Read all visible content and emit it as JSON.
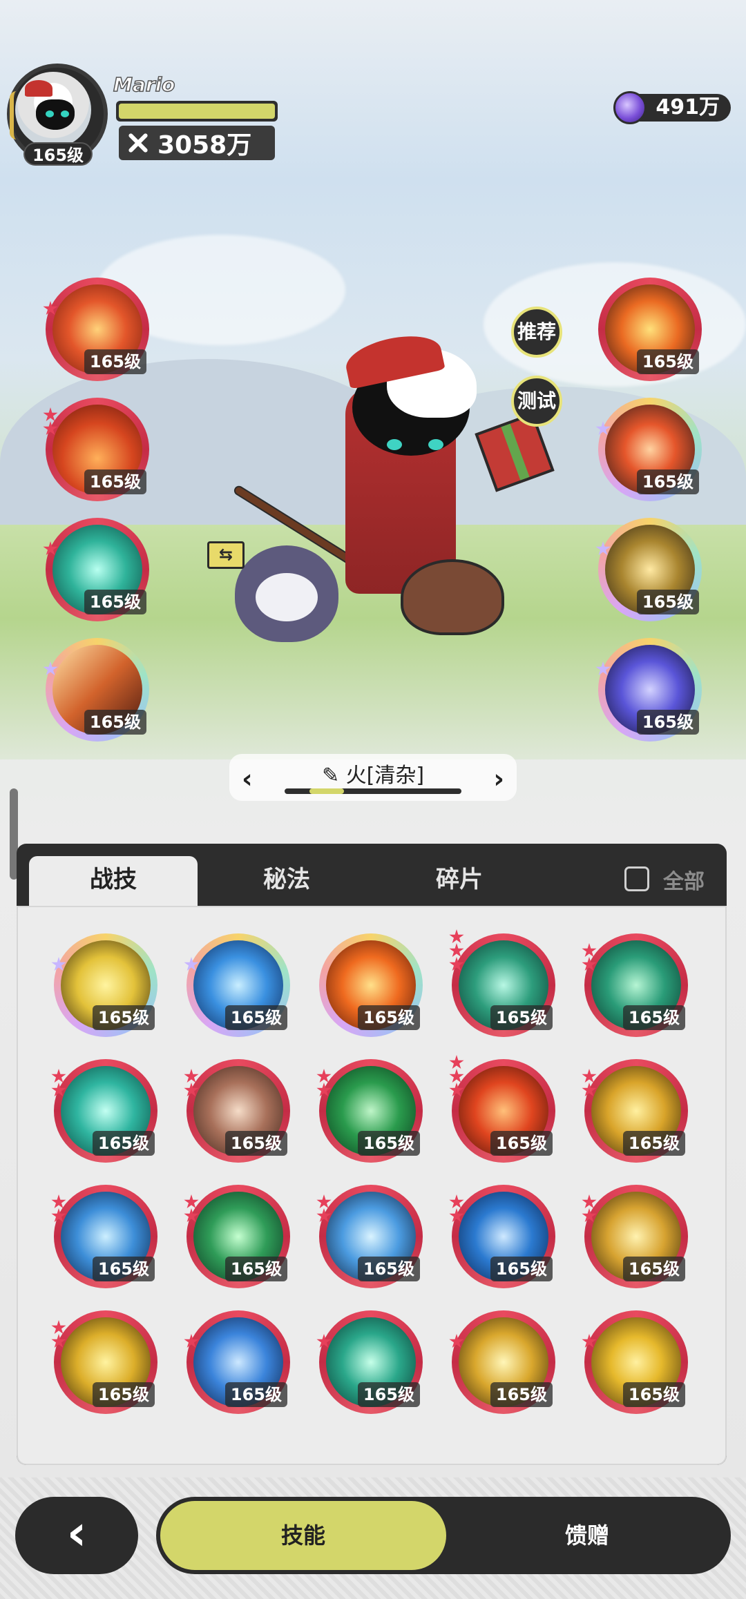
{
  "player": {
    "name": "Mario",
    "level": "165级",
    "power": "3058万",
    "hp_fraction": 1.0
  },
  "currency": {
    "amount": "491万",
    "icon": "purple-gem-icon"
  },
  "side_buttons": {
    "recommend": "推荐",
    "test": "测试"
  },
  "pet": {
    "swap_icon": "swap-icon",
    "swap_glyph": "⇆"
  },
  "equipped_left": [
    {
      "level": "165级",
      "icon": "fire-burst-icon",
      "ring": "red",
      "stars": 1
    },
    {
      "level": "165级",
      "icon": "flame-wave-icon",
      "ring": "red",
      "stars": 2
    },
    {
      "level": "165级",
      "icon": "wind-swirl-icon",
      "ring": "red",
      "stars": 1
    },
    {
      "level": "165级",
      "icon": "meteor-icon",
      "ring": "rainbow",
      "stars": 1
    }
  ],
  "equipped_right": [
    {
      "level": "165级",
      "icon": "fire-spirit-icon",
      "ring": "red",
      "stars": 0
    },
    {
      "level": "165级",
      "icon": "fire-orb-icon",
      "ring": "rainbow",
      "stars": 1
    },
    {
      "level": "165级",
      "icon": "golden-slash-icon",
      "ring": "rainbow",
      "stars": 1
    },
    {
      "level": "165级",
      "icon": "clock-magic-icon",
      "ring": "rainbow",
      "stars": 1
    }
  ],
  "preset": {
    "prev": "‹",
    "next": "›",
    "name": "火[清杂]",
    "edit_icon": "pencil-icon"
  },
  "tabs": {
    "combat": "战技",
    "secret": "秘法",
    "fragments": "碎片",
    "all": "全部"
  },
  "skill_grid": [
    [
      {
        "level": "165级",
        "icon": "lightning-fox-icon",
        "ring": "rainbow",
        "stars": 1
      },
      {
        "level": "165级",
        "icon": "water-vortex-icon",
        "ring": "rainbow",
        "stars": 1
      },
      {
        "level": "165级",
        "icon": "fire-blast-icon",
        "ring": "rainbow",
        "stars": 0
      },
      {
        "level": "165级",
        "icon": "wind-sphere-icon",
        "ring": "red",
        "stars": 3
      },
      {
        "level": "165级",
        "icon": "thorn-vine-icon",
        "ring": "red",
        "stars": 2
      }
    ],
    [
      {
        "level": "165级",
        "icon": "whirlpool-icon",
        "ring": "red",
        "stars": 2
      },
      {
        "level": "165级",
        "icon": "rock-shield-icon",
        "ring": "red",
        "stars": 2
      },
      {
        "level": "165级",
        "icon": "heal-cross-icon",
        "ring": "red",
        "stars": 2
      },
      {
        "level": "165级",
        "icon": "fire-wall-icon",
        "ring": "red",
        "stars": 3
      },
      {
        "level": "165级",
        "icon": "thunder-strike-icon",
        "ring": "red",
        "stars": 2
      }
    ],
    [
      {
        "level": "165级",
        "icon": "ice-shard-icon",
        "ring": "red",
        "stars": 2
      },
      {
        "level": "165级",
        "icon": "green-flame-icon",
        "ring": "red",
        "stars": 2
      },
      {
        "level": "165级",
        "icon": "ice-crystal-icon",
        "ring": "red",
        "stars": 2
      },
      {
        "level": "165级",
        "icon": "tidal-wave-icon",
        "ring": "red",
        "stars": 2
      },
      {
        "level": "165级",
        "icon": "star-shot-icon",
        "ring": "red",
        "stars": 2
      }
    ],
    [
      {
        "level": "165级",
        "icon": "lightning-bolt-icon",
        "ring": "red",
        "stars": 2
      },
      {
        "level": "165级",
        "icon": "blue-fire-icon",
        "ring": "red",
        "stars": 1
      },
      {
        "level": "165级",
        "icon": "green-wind-icon",
        "ring": "red",
        "stars": 1
      },
      {
        "level": "165级",
        "icon": "light-burst-icon",
        "ring": "red",
        "stars": 1
      },
      {
        "level": "165级",
        "icon": "sun-icon",
        "ring": "red",
        "stars": 1
      }
    ]
  ],
  "nav": {
    "back": "‹",
    "skills": "技能",
    "gifts": "馈赠"
  },
  "colors": {
    "accent": "#d3d66a",
    "dark": "#2b2b2b",
    "ring_red": "#e84a5f"
  }
}
